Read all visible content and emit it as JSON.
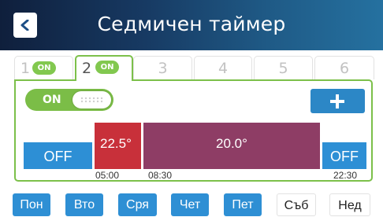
{
  "header": {
    "title": "Седмичен таймер"
  },
  "tabs": [
    {
      "label": "1",
      "status": "ON"
    },
    {
      "label": "2",
      "status": "ON",
      "active": true
    },
    {
      "label": "3"
    },
    {
      "label": "4"
    },
    {
      "label": "5"
    },
    {
      "label": "6"
    }
  ],
  "panel": {
    "toggle_label": "ON",
    "schedule": [
      {
        "label": "OFF"
      },
      {
        "label": "22.5°",
        "color": "#c8303a"
      },
      {
        "label": "20.0°",
        "color": "#8e3d65"
      },
      {
        "label": "OFF"
      }
    ],
    "times": [
      "05:00",
      "08:30",
      "22:30"
    ]
  },
  "days": [
    {
      "label": "Пон",
      "active": true
    },
    {
      "label": "Вто",
      "active": true
    },
    {
      "label": "Сря",
      "active": true
    },
    {
      "label": "Чет",
      "active": true
    },
    {
      "label": "Пет",
      "active": true
    },
    {
      "label": "Съб",
      "active": false
    },
    {
      "label": "Нед",
      "active": false
    }
  ],
  "colors": {
    "accent_green": "#7cc04a",
    "accent_blue": "#2d8fd5"
  },
  "icons": {
    "back": "chevron-left-icon",
    "add": "plus-icon",
    "toggle": "grip-icon"
  }
}
